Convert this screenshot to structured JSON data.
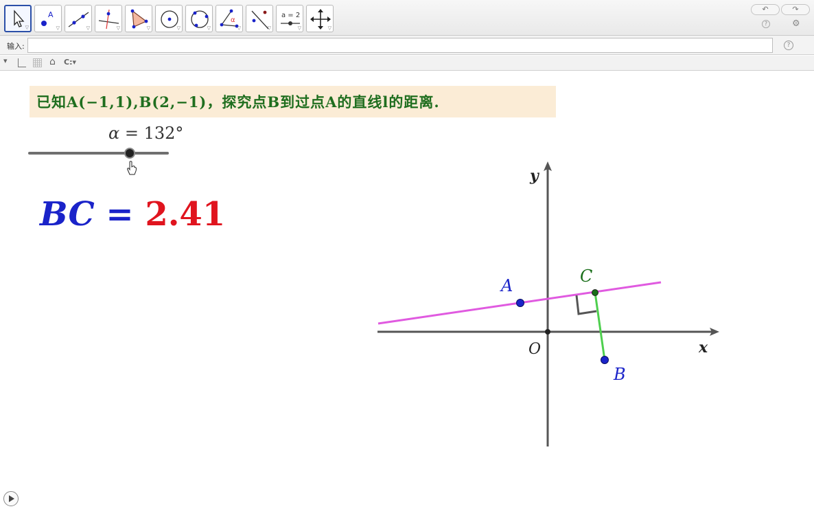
{
  "toolbar": {
    "tools": [
      {
        "name": "move-tool",
        "icon": "arrow-cursor-icon"
      },
      {
        "name": "point-tool",
        "icon": "point-icon",
        "glyph": "A"
      },
      {
        "name": "line-tool",
        "icon": "line-icon"
      },
      {
        "name": "perpendicular-line-tool",
        "icon": "perpendicular-icon"
      },
      {
        "name": "polygon-tool",
        "icon": "polygon-icon"
      },
      {
        "name": "circle-tool",
        "icon": "circle-center-icon"
      },
      {
        "name": "circle-three-points-tool",
        "icon": "circle-three-points-icon"
      },
      {
        "name": "angle-tool",
        "icon": "angle-icon",
        "glyph": "α"
      },
      {
        "name": "reflect-tool",
        "icon": "reflect-line-icon"
      },
      {
        "name": "slider-tool",
        "icon": "slider-icon",
        "glyph": "a = 2"
      },
      {
        "name": "move-view-tool",
        "icon": "move-view-icon"
      }
    ],
    "undo_icon": "↶",
    "redo_icon": "↷",
    "help_glyph": "?",
    "settings_glyph": "⚙"
  },
  "inputbar": {
    "label": "输入:",
    "value": "",
    "help_glyph": "?"
  },
  "graphics_bar": {
    "menu_glyph": "▾",
    "home_glyph": "⌂",
    "caps_label": "C:"
  },
  "problem": {
    "text": "已知A(−1,1),B(2,−1)，探究点B到过点A的直线l的距离."
  },
  "slider": {
    "variable": "α",
    "equals": " = ",
    "value": "132",
    "unit": "°",
    "fraction": 0.72
  },
  "measure": {
    "label": "BC",
    "equals": " = ",
    "value": "2.41"
  },
  "plot": {
    "axis_x_label": "x",
    "axis_y_label": "y",
    "origin_label": "O",
    "points": {
      "A": {
        "label": "A",
        "x": -1,
        "y": 1,
        "color": "#1a23c9"
      },
      "B": {
        "label": "B",
        "x": 2,
        "y": -1,
        "color": "#1a23c9"
      },
      "C": {
        "label": "C",
        "x": 1.64,
        "y": 1.38,
        "color": "#1a6e1a"
      }
    },
    "line_color": "#e05ae0",
    "segment_color": "#4ecf4e"
  }
}
